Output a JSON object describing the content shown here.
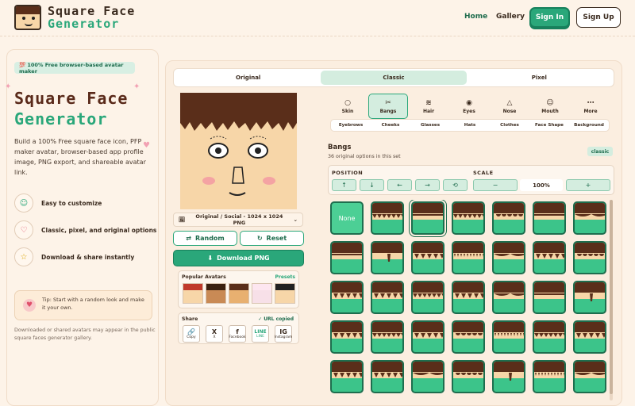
{
  "header": {
    "logo_line1": "Square Face",
    "logo_line2": "Generator",
    "nav_home": "Home",
    "nav_gallery": "Gallery",
    "signin": "Sign In",
    "signup": "Sign Up",
    "accent": "#2aa77a"
  },
  "left": {
    "badge": "💯 100% Free browser-based avatar maker",
    "title1": "Square Face",
    "title2": "Generator",
    "description": "Build a 100% Free square face icon, PFP maker avatar, browser-based app profile image, PNG export, and shareable avatar link.",
    "features": [
      {
        "icon": "smile-icon",
        "label": "Easy to customize"
      },
      {
        "icon": "heart-icon",
        "label": "Classic, pixel, and original options"
      },
      {
        "icon": "star-icon",
        "label": "Download & share instantly"
      }
    ],
    "tip": "Tip: Start with a random look and make it your own.",
    "note": "Downloaded or shared avatars may appear in the public square faces generator gallery."
  },
  "editor": {
    "style_tabs": [
      "Original",
      "Classic",
      "Pixel"
    ],
    "active_style": "Classic",
    "size_select": "Original / Social - 1024 x 1024 PNG",
    "random": "Random",
    "reset": "Reset",
    "download": "Download PNG",
    "popular_title": "Popular Avatars",
    "presets": "Presets",
    "share_title": "Share",
    "url_copied": "URL copied",
    "share_buttons": [
      {
        "glyph": "🔗",
        "label": "Copy"
      },
      {
        "glyph": "X",
        "label": "X"
      },
      {
        "glyph": "f",
        "label": "Facebook"
      },
      {
        "glyph": "LINE",
        "label": "LINE"
      },
      {
        "glyph": "IG",
        "label": "Instagram"
      }
    ]
  },
  "tools": {
    "row1": [
      {
        "icon": "circle-icon",
        "label": "Skin"
      },
      {
        "icon": "scissors-icon",
        "label": "Bangs"
      },
      {
        "icon": "hair-icon",
        "label": "Hair"
      },
      {
        "icon": "eye-icon",
        "label": "Eyes"
      },
      {
        "icon": "triangle-icon",
        "label": "Nose"
      },
      {
        "icon": "smile-icon",
        "label": "Mouth"
      },
      {
        "icon": "dots-icon",
        "label": "More"
      }
    ],
    "active": "Bangs",
    "row2": [
      "Eyebrows",
      "Cheeks",
      "Glasses",
      "Hats",
      "Clothes",
      "Face Shape",
      "Background"
    ]
  },
  "bangs": {
    "title": "Bangs",
    "subtitle": "36 original options in this set",
    "set_badge": "classic",
    "position_label": "POSITION",
    "scale_label": "SCALE",
    "arrows": [
      "↑",
      "↓",
      "←",
      "→",
      "⟲"
    ],
    "scale_minus": "−",
    "scale_value": "100%",
    "scale_plus": "+",
    "none_label": "None"
  }
}
